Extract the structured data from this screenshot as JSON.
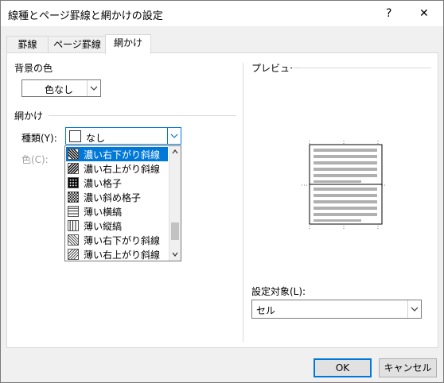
{
  "title": "線種とページ罫線と網かけの設定",
  "help_label": "?",
  "close_label": "✕",
  "tabs": [
    {
      "label": "罫線"
    },
    {
      "label": "ページ罫線"
    },
    {
      "label": "網かけ"
    }
  ],
  "background": {
    "section_label": "背景の色",
    "value": "色なし"
  },
  "shading": {
    "section_label": "網かけ",
    "type_label": "種類(Y):",
    "type_value": "なし",
    "color_label": "色(C):",
    "options": [
      {
        "label": "濃い右下がり斜線",
        "selected": true
      },
      {
        "label": "濃い右上がり斜線"
      },
      {
        "label": "濃い格子"
      },
      {
        "label": "濃い斜め格子"
      },
      {
        "label": "薄い横縞"
      },
      {
        "label": "薄い縦縞"
      },
      {
        "label": "薄い右下がり斜線"
      },
      {
        "label": "薄い右上がり斜線"
      }
    ]
  },
  "preview": {
    "label": "プレビュー"
  },
  "apply_to": {
    "label": "設定対象(L):",
    "value": "セル"
  },
  "buttons": {
    "ok": "OK",
    "cancel": "キャンセル"
  },
  "colors": {
    "accent": "#0078d7",
    "selected_text": "#ffffff",
    "disabled": "#a0a0a0"
  }
}
